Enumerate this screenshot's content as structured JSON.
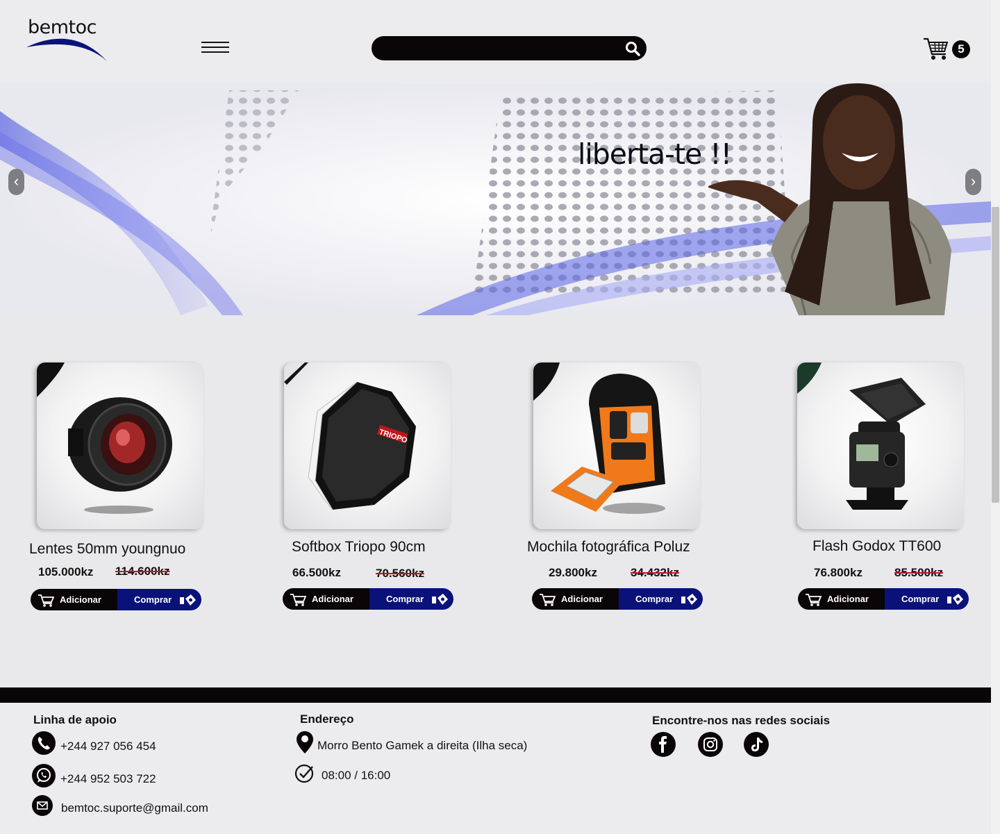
{
  "brand": {
    "logo_text": "bemtoc"
  },
  "header": {
    "search_placeholder": "",
    "cart_count": "5"
  },
  "hero": {
    "headline": "liberta-te !!",
    "prev_label": "‹",
    "next_label": "›"
  },
  "products": [
    {
      "name": "Lentes 50mm youngnuo",
      "price": "105.000kz",
      "old_price": "114.600kz",
      "add_label": "Adicionar",
      "buy_label": "Comprar",
      "image": "camera-lens"
    },
    {
      "name": "Softbox Triopo 90cm",
      "price": "66.500kz",
      "old_price": "70.560kz",
      "add_label": "Adicionar",
      "buy_label": "Comprar",
      "image": "octagonal-softbox",
      "image_brand": "TRIOPO"
    },
    {
      "name": "Mochila fotográfica Poluz",
      "price": "29.800kz",
      "old_price": "34.432kz",
      "add_label": "Adicionar",
      "buy_label": "Comprar",
      "image": "camera-backpack"
    },
    {
      "name": "Flash Godox TT600",
      "price": "76.800kz",
      "old_price": "85.500kz",
      "add_label": "Adicionar",
      "buy_label": "Comprar",
      "image": "speedlite-flash"
    }
  ],
  "footer": {
    "support_title": "Linha de apoio",
    "phone": "+244 927 056 454",
    "whatsapp": "+244 952 503 722",
    "email": "bemtoc.suporte@gmail.com",
    "address_title": "Endereço",
    "address": "Morro Bento Gamek a direita (Ilha seca)",
    "hours": "08:00 / 16:00",
    "social_title": "Encontre-nos nas redes sociais",
    "social": [
      "facebook",
      "instagram",
      "tiktok"
    ]
  },
  "colors": {
    "dark": "#0a0506",
    "buy_blue": "#0a127a",
    "strike_red": "#c8102e",
    "hero_blue": "#5a64e6"
  }
}
